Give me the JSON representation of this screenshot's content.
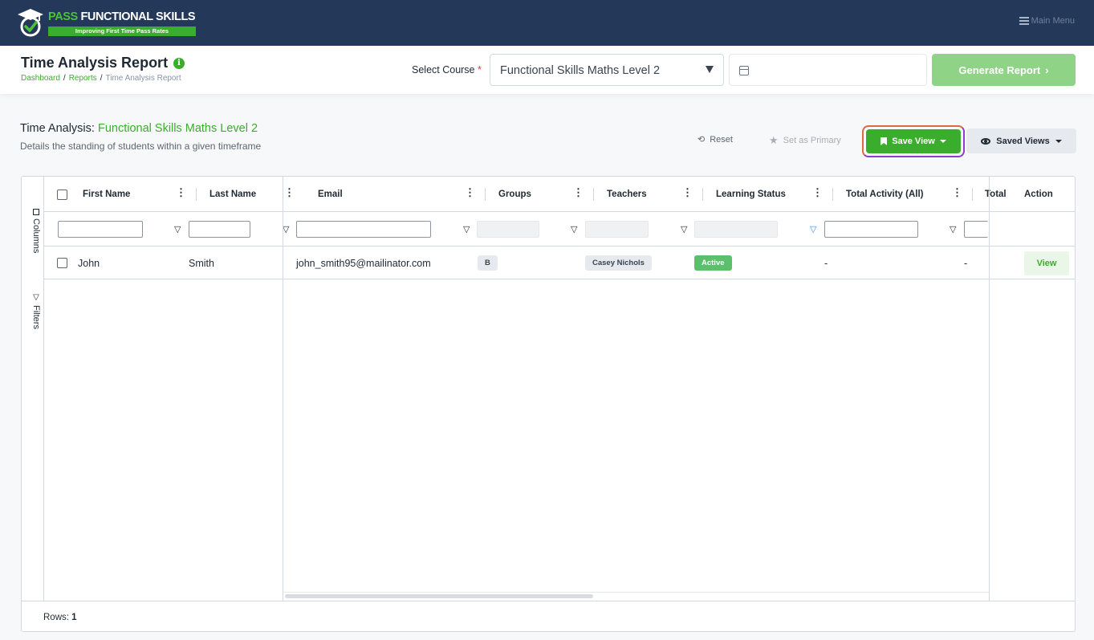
{
  "brand": {
    "name_pass": "PASS",
    "name_rest": " FUNCTIONAL SKILLS",
    "tagline": "Improving First Time Pass Rates"
  },
  "nav": {
    "main_menu": "Main Menu"
  },
  "header": {
    "title": "Time Analysis Report",
    "breadcrumb": [
      "Dashboard",
      "Reports",
      "Time Analysis Report"
    ],
    "select_label": "Select Course",
    "required_mark": "*",
    "course_value": "Functional Skills Maths Level 2",
    "date_placeholder": "",
    "generate_label": "Generate Report"
  },
  "section": {
    "title_prefix": "Time Analysis:",
    "title_course": "Functional Skills Maths Level 2",
    "subtitle": "Details the standing of students within a given timeframe"
  },
  "toolbar": {
    "reset": "Reset",
    "set_primary": "Set as Primary",
    "save_view": "Save View",
    "saved_views": "Saved Views"
  },
  "side_panel": {
    "columns": "Columns",
    "filters": "Filters"
  },
  "columns": [
    "First Name",
    "Last Name",
    "Email",
    "Groups",
    "Teachers",
    "Learning Status",
    "Total Activity (All)",
    "Total",
    "Action"
  ],
  "rows": [
    {
      "first_name": "John",
      "last_name": "Smith",
      "email": "john_smith95@mailinator.com",
      "group": "B",
      "teacher": "Casey Nichols",
      "status": "Active",
      "total_activity": "-",
      "total": "-",
      "action": "View"
    }
  ],
  "footer": {
    "rows_label": "Rows:",
    "rows_count": "1"
  },
  "colors": {
    "accent_green": "#3aad2c",
    "nav_bg": "#24395a"
  }
}
